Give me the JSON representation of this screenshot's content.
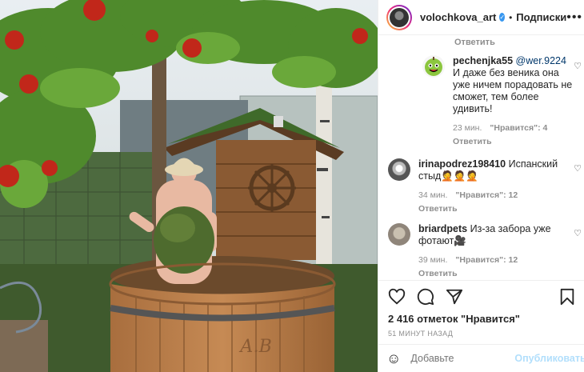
{
  "header": {
    "username": "volochkova_art",
    "separator": "•",
    "follow_label": "Подписки",
    "more_label": "•••"
  },
  "comments": {
    "top_reply_label": "Ответить",
    "items": [
      {
        "user": "pechenjka55",
        "mention": "@wer.9224",
        "text": "И даже без веника она уже ничем порадовать не сможет, тем более удивить!",
        "time": "23 мин.",
        "likes": "\"Нравится\": 4",
        "reply": "Ответить"
      },
      {
        "user": "irinapodrez198410",
        "text": "Испанский стыд🤦🤦🤦",
        "time": "34 мин.",
        "likes": "\"Нравится\": 12",
        "reply": "Ответить"
      },
      {
        "user": "briardpets",
        "text": "Из-за забора уже фотают🎥",
        "time": "39 мин.",
        "likes": "\"Нравится\": 12",
        "reply": "Ответить"
      }
    ]
  },
  "post": {
    "likes_text": "2 416 отметок \"Нравится\"",
    "time_ago": "51 МИНУТ НАЗАД"
  },
  "composer": {
    "placeholder": "Добавьте",
    "publish_label": "Опубликовать"
  },
  "photo": {
    "tub_inscription": "А.В"
  }
}
